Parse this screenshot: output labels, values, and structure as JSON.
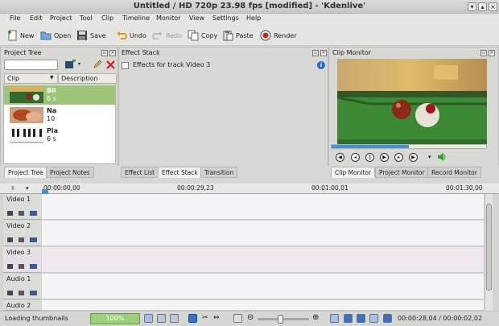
{
  "window": {
    "title": "Untitled / HD 720p 23.98 fps [modified] - 'Kdenlive'"
  },
  "menu": [
    "File",
    "Edit",
    "Project",
    "Tool",
    "Clip",
    "Timeline",
    "Monitor",
    "View",
    "Settings",
    "Help"
  ],
  "toolbar": {
    "new_label": "New",
    "open_label": "Open",
    "save_label": "Save",
    "undo_label": "Undo",
    "redo_label": "Redo",
    "copy_label": "Copy",
    "paste_label": "Paste",
    "render_label": "Render"
  },
  "project_tree": {
    "title": "Project Tree",
    "col_clip": "Clip",
    "col_description": "Description",
    "items": [
      {
        "name": "Bil",
        "desc": "6 s",
        "selected": true
      },
      {
        "name": "Na",
        "desc": "10",
        "selected": false
      },
      {
        "name": "Pia",
        "desc": "6 s",
        "selected": false
      }
    ],
    "tabs": [
      "Project Tree",
      "Project Notes"
    ]
  },
  "effect_stack": {
    "title": "Effect Stack",
    "checkbox_label": "Effects for track Video 3",
    "tabs": [
      "Effect List",
      "Effect Stack",
      "Transition"
    ]
  },
  "clip_monitor": {
    "title": "Clip Monitor",
    "tabs": [
      "Clip Monitor",
      "Project Monitor",
      "Record Monitor"
    ],
    "progress": 0.5
  },
  "timeline": {
    "ruler": [
      "00:00:00,00",
      "00:00:29,23",
      "00:01:00,01",
      "00:01:30,00"
    ],
    "tracks": [
      "Video 1",
      "Video 2",
      "Video 3",
      "Audio 1",
      "Audio 2"
    ]
  },
  "status": {
    "message": "Loading thumbnails",
    "progress_label": "100%",
    "timecode": "00:00:28,04 / 00:00:02,02"
  },
  "colors": {
    "selection": "#9dc57a",
    "accent": "#4a90d9",
    "render": "#cc2222"
  }
}
